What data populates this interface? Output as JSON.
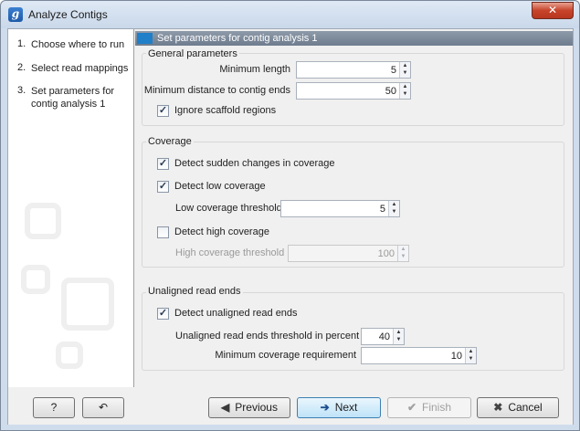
{
  "window": {
    "title": "Analyze Contigs",
    "close_symbol": "✕"
  },
  "steps": [
    {
      "num": "1.",
      "label": "Choose where to run"
    },
    {
      "num": "2.",
      "label": "Select read mappings"
    },
    {
      "num": "3.",
      "label": "Set parameters for contig analysis 1"
    }
  ],
  "panel": {
    "header": "Set parameters for contig analysis 1"
  },
  "general": {
    "title": "General parameters",
    "min_length_label": "Minimum length",
    "min_length_value": "5",
    "min_distance_label": "Minimum distance to contig ends",
    "min_distance_value": "50",
    "ignore_scaffold_label": "Ignore scaffold regions",
    "ignore_scaffold_checked": "✓"
  },
  "coverage": {
    "title": "Coverage",
    "sudden_label": "Detect sudden changes in coverage",
    "sudden_checked": "✓",
    "low_label": "Detect low coverage",
    "low_checked": "✓",
    "low_threshold_label": "Low coverage threshold",
    "low_threshold_value": "5",
    "high_label": "Detect high coverage",
    "high_threshold_label": "High coverage threshold",
    "high_threshold_value": "100"
  },
  "unaligned": {
    "title": "Unaligned read ends",
    "detect_label": "Detect unaligned read ends",
    "detect_checked": "✓",
    "threshold_label": "Unaligned read ends threshold in percent",
    "threshold_value": "40",
    "min_cov_label": "Minimum coverage requirement",
    "min_cov_value": "10"
  },
  "spin_arrows": {
    "up": "▲",
    "down": "▼"
  },
  "footer": {
    "help_label": "?",
    "reset_icon": "↶",
    "previous_label": "Previous",
    "previous_icon": "◀",
    "next_label": "Next",
    "next_icon": "➔",
    "finish_label": "Finish",
    "finish_icon": "✔",
    "cancel_label": "Cancel",
    "cancel_icon": "✖"
  }
}
